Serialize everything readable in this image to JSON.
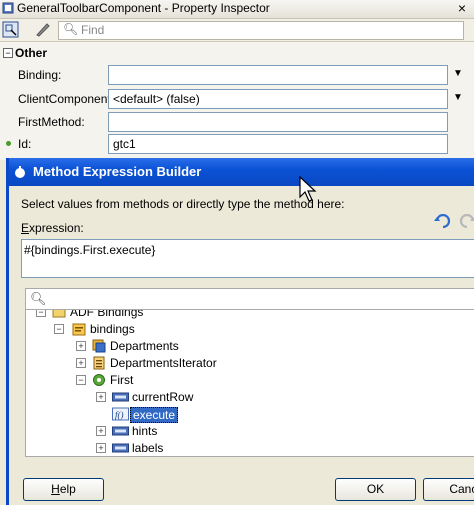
{
  "property_inspector": {
    "title": "GeneralToolbarComponent - Property Inspector",
    "close_glyph": "×",
    "search_placeholder": "Find",
    "section": "Other",
    "section_toggle": "−",
    "properties": [
      {
        "label": "Binding:",
        "value": "",
        "has_dropdown": true
      },
      {
        "label": "ClientComponent:",
        "value": "<default> (false)",
        "has_dropdown": true
      },
      {
        "label": "FirstMethod:",
        "value": "",
        "has_dropdown": false
      },
      {
        "label": "Id:",
        "value": "gtc1",
        "has_dropdown": false
      }
    ]
  },
  "dialog": {
    "title": "Method Expression Builder",
    "instruction": "Select values from methods or directly type the method here:",
    "expression_label_mnemonic": "E",
    "expression_label_rest": "xpression:",
    "expression_value": "#{bindings.First.execute}",
    "tree": [
      {
        "label": "ADF Bindings",
        "toggle": "−",
        "icon": "folder-icon"
      },
      {
        "label": "bindings",
        "toggle": "−",
        "icon": "bindings-icon"
      },
      {
        "label": "Departments",
        "toggle": "+",
        "icon": "iterator-icon"
      },
      {
        "label": "DepartmentsIterator",
        "toggle": "+",
        "icon": "list-icon"
      },
      {
        "label": "First",
        "toggle": "−",
        "icon": "gear-icon"
      },
      {
        "label": "currentRow",
        "toggle": "+",
        "icon": "xyz-icon"
      },
      {
        "label": "execute",
        "toggle": "",
        "icon": "function-icon",
        "selected": true
      },
      {
        "label": "hints",
        "toggle": "+",
        "icon": "xyz-icon"
      },
      {
        "label": "labels",
        "toggle": "+",
        "icon": "xyz-icon"
      }
    ],
    "buttons": {
      "help_mnemonic": "H",
      "help_rest": "elp",
      "ok": "OK",
      "cancel": "Cance"
    }
  },
  "colors": {
    "dialog_title_bar": "#0b52d6",
    "selection": "#316ac5"
  }
}
